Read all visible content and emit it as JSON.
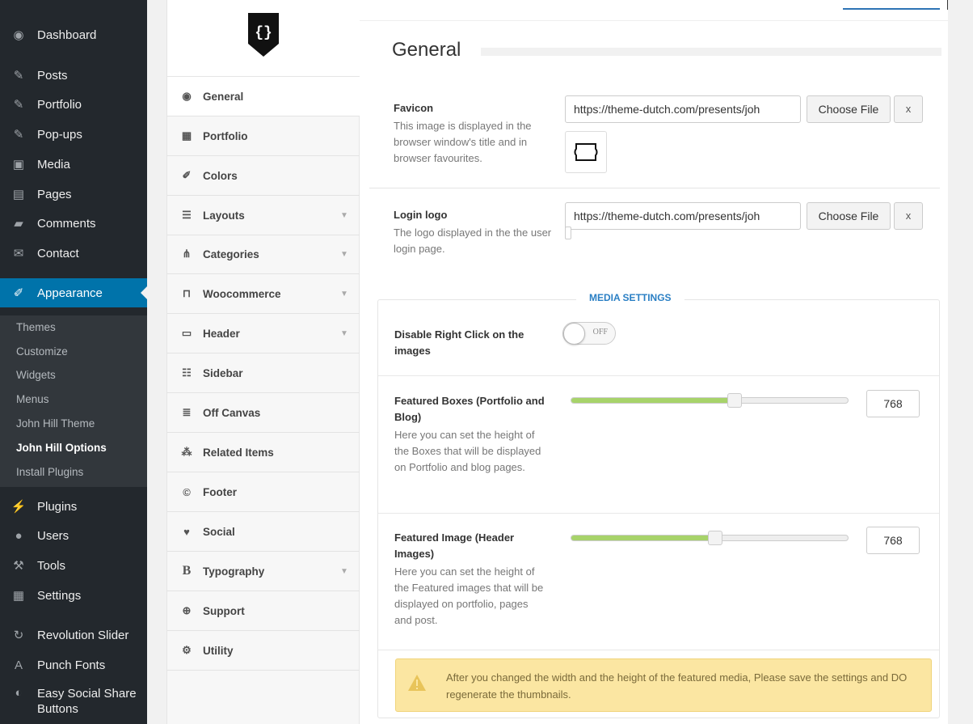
{
  "wp_menu": {
    "items": [
      {
        "label": "Dashboard",
        "icon": "dashboard-icon"
      },
      {
        "label": "Posts",
        "icon": "pin-icon"
      },
      {
        "label": "Portfolio",
        "icon": "pin-icon"
      },
      {
        "label": "Pop-ups",
        "icon": "pin-icon"
      },
      {
        "label": "Media",
        "icon": "media-icon"
      },
      {
        "label": "Pages",
        "icon": "pages-icon"
      },
      {
        "label": "Comments",
        "icon": "comment-icon"
      },
      {
        "label": "Contact",
        "icon": "mail-icon"
      },
      {
        "label": "Appearance",
        "icon": "brush-icon"
      },
      {
        "label": "Plugins",
        "icon": "plug-icon"
      },
      {
        "label": "Users",
        "icon": "users-icon"
      },
      {
        "label": "Tools",
        "icon": "wrench-icon"
      },
      {
        "label": "Settings",
        "icon": "settings-icon"
      },
      {
        "label": "Revolution Slider",
        "icon": "refresh-icon"
      },
      {
        "label": "Punch Fonts",
        "icon": "font-icon"
      },
      {
        "label": "Easy Social Share Buttons",
        "icon": "share-icon"
      }
    ],
    "submenu": [
      "Themes",
      "Customize",
      "Widgets",
      "Menus",
      "John Hill Theme",
      "John Hill Options",
      "Install Plugins"
    ]
  },
  "options_nav": {
    "items": [
      {
        "label": "General",
        "icon": "dashboard-icon"
      },
      {
        "label": "Portfolio",
        "icon": "grid-icon"
      },
      {
        "label": "Colors",
        "icon": "brush-icon"
      },
      {
        "label": "Layouts",
        "icon": "align-icon"
      },
      {
        "label": "Categories",
        "icon": "sitemap-icon"
      },
      {
        "label": "Woocommerce",
        "icon": "cart-icon"
      },
      {
        "label": "Header",
        "icon": "header-icon"
      },
      {
        "label": "Sidebar",
        "icon": "list-icon"
      },
      {
        "label": "Off Canvas",
        "icon": "menu-icon"
      },
      {
        "label": "Related Items",
        "icon": "cubes-icon"
      },
      {
        "label": "Footer",
        "icon": "copyright-icon"
      },
      {
        "label": "Social",
        "icon": "twitter-icon"
      },
      {
        "label": "Typography",
        "icon": "bold-icon"
      },
      {
        "label": "Support",
        "icon": "lifebuoy-icon"
      },
      {
        "label": "Utility",
        "icon": "tools-icon"
      }
    ]
  },
  "content": {
    "section_title": "General",
    "favicon": {
      "label": "Favicon",
      "description": "This image is displayed in the browser window's title and in browser favourites.",
      "url": "https://theme-dutch.com/presents/joh",
      "choose_label": "Choose File",
      "remove_label": "x"
    },
    "login_logo": {
      "label": "Login logo",
      "description": "The logo displayed in the the user login page.",
      "url": "https://theme-dutch.com/presents/joh",
      "choose_label": "Choose File",
      "remove_label": "x"
    },
    "media_settings": {
      "legend": "MEDIA SETTINGS",
      "right_click": {
        "label": "Disable Right Click on the images",
        "toggle_text": "OFF",
        "enabled": false
      },
      "featured_boxes": {
        "label": "Featured Boxes (Portfolio and Blog)",
        "description": "Here you can set the height of the Boxes that will be displayed on Portfolio and blog pages.",
        "value": "768",
        "fraction": 0.59
      },
      "featured_image": {
        "label": "Featured Image (Header Images)",
        "description": "Here you can set the height of the Featured images that will be displayed on portfolio, pages and post.",
        "value": "768",
        "fraction": 0.52
      },
      "warning": "After you changed the width and the height of the featured media, Please save the settings and DO regenerate the thumbnails."
    }
  },
  "colors": {
    "wp_sidebar": "#23282d",
    "wp_active": "#0073aa",
    "accent_blue": "#2a7fc4",
    "slider_green": "#a7d36a",
    "warning_bg": "#fbe6a2"
  }
}
